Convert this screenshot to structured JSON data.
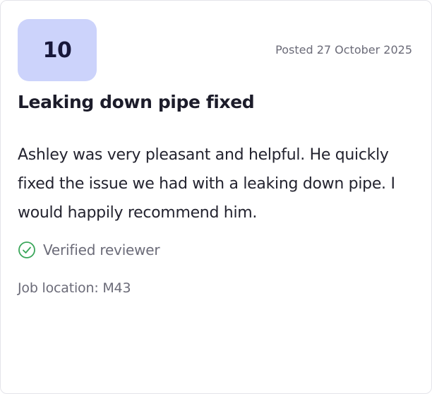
{
  "review": {
    "score": "10",
    "posted": "Posted 27 October 2025",
    "title": "Leaking down pipe fixed",
    "body": "Ashley was very pleasant and helpful. He quickly fixed the issue we had with a leaking down pipe. I would happily recommend him.",
    "verified_label": "Verified reviewer",
    "verified_icon": "check-circle-icon",
    "job_location": "Job location: M43"
  },
  "colors": {
    "badge_background": "#ccd3fb",
    "verified_check": "#3aa65a",
    "muted_text": "#6b6b78"
  }
}
